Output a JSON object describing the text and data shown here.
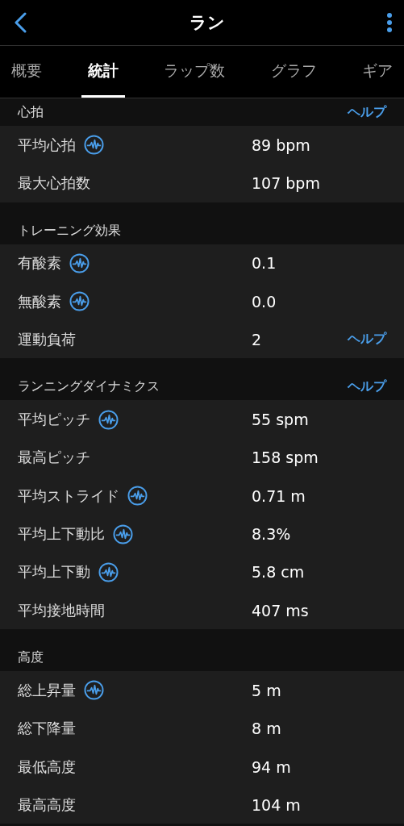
{
  "header": {
    "title": "ラン"
  },
  "tabs": [
    {
      "label": "概要",
      "selected": false
    },
    {
      "label": "統計",
      "selected": true
    },
    {
      "label": "ラップ数",
      "selected": false
    },
    {
      "label": "グラフ",
      "selected": false
    },
    {
      "label": "ギア",
      "selected": false
    }
  ],
  "sections": [
    {
      "title": "心拍",
      "help": "ヘルプ",
      "rows": [
        {
          "label": "平均心拍",
          "chart_icon": true,
          "value": "89 bpm"
        },
        {
          "label": "最大心拍数",
          "chart_icon": false,
          "value": "107 bpm"
        }
      ]
    },
    {
      "title": "トレーニング効果",
      "rows": [
        {
          "label": "有酸素",
          "chart_icon": true,
          "value": "0.1"
        },
        {
          "label": "無酸素",
          "chart_icon": true,
          "value": "0.0"
        },
        {
          "label": "運動負荷",
          "chart_icon": false,
          "value": "2",
          "help": "ヘルプ"
        }
      ]
    },
    {
      "title": "ランニングダイナミクス",
      "help": "ヘルプ",
      "rows": [
        {
          "label": "平均ピッチ",
          "chart_icon": true,
          "value": "55 spm"
        },
        {
          "label": "最高ピッチ",
          "chart_icon": false,
          "value": "158 spm"
        },
        {
          "label": "平均ストライド",
          "chart_icon": true,
          "value": "0.71 m"
        },
        {
          "label": "平均上下動比",
          "chart_icon": true,
          "value": "8.3%"
        },
        {
          "label": "平均上下動",
          "chart_icon": true,
          "value": "5.8 cm"
        },
        {
          "label": "平均接地時間",
          "chart_icon": false,
          "value": "407 ms"
        }
      ]
    },
    {
      "title": "高度",
      "rows": [
        {
          "label": "総上昇量",
          "chart_icon": true,
          "value": "5 m"
        },
        {
          "label": "総下降量",
          "chart_icon": false,
          "value": "8 m"
        },
        {
          "label": "最低高度",
          "chart_icon": false,
          "value": "94 m"
        },
        {
          "label": "最高高度",
          "chart_icon": false,
          "value": "104 m"
        }
      ]
    }
  ]
}
